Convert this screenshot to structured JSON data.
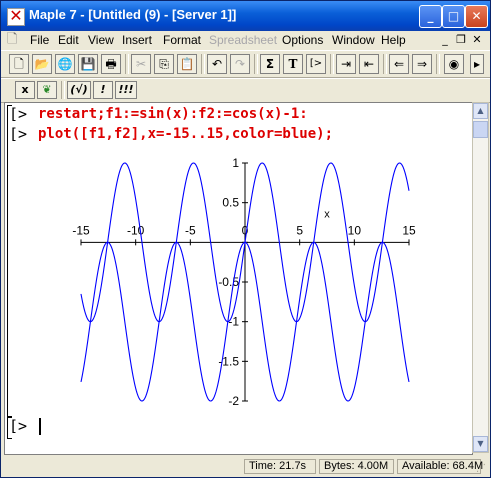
{
  "window": {
    "title": "Maple 7  - [Untitled (9) - [Server 1]]",
    "controls": {
      "minimize": "_",
      "maximize": "□",
      "close": "✕"
    }
  },
  "menubar": {
    "items": [
      {
        "label": "File",
        "enabled": true
      },
      {
        "label": "Edit",
        "enabled": true
      },
      {
        "label": "View",
        "enabled": true
      },
      {
        "label": "Insert",
        "enabled": true
      },
      {
        "label": "Format",
        "enabled": true
      },
      {
        "label": "Spreadsheet",
        "enabled": false
      },
      {
        "label": "Options",
        "enabled": true
      },
      {
        "label": "Window",
        "enabled": true
      },
      {
        "label": "Help",
        "enabled": true
      }
    ],
    "doc_controls": {
      "minimize": "_",
      "restore": "❐",
      "close": "✕"
    }
  },
  "toolbar1": {
    "buttons": [
      {
        "icon": "new-document-icon",
        "glyph": "🗋"
      },
      {
        "icon": "open-folder-icon",
        "glyph": "📂"
      },
      {
        "icon": "open-url-icon",
        "glyph": "🌐"
      },
      {
        "icon": "save-icon",
        "glyph": "💾"
      },
      {
        "icon": "print-icon",
        "glyph": "🖶"
      },
      {
        "icon": "cut-icon",
        "glyph": "✂"
      },
      {
        "icon": "copy-icon",
        "glyph": "⎘"
      },
      {
        "icon": "paste-icon",
        "glyph": "📋"
      },
      {
        "icon": "undo-icon",
        "glyph": "↶"
      },
      {
        "icon": "redo-icon",
        "glyph": "↷"
      },
      {
        "icon": "sigma-icon",
        "glyph": "Σ"
      },
      {
        "icon": "text-icon",
        "glyph": "T"
      },
      {
        "icon": "insert-prompt-icon",
        "glyph": "[>"
      },
      {
        "icon": "indent-icon",
        "glyph": "⇥"
      },
      {
        "icon": "outdent-icon",
        "glyph": "⇤"
      },
      {
        "icon": "back-arrow-icon",
        "glyph": "⇐"
      },
      {
        "icon": "forward-arrow-icon",
        "glyph": "⇒"
      },
      {
        "icon": "stop-icon",
        "glyph": "◉"
      }
    ]
  },
  "toolbar2": {
    "buttons": [
      {
        "icon": "clear-icon",
        "glyph": "x"
      },
      {
        "icon": "maple-leaf-icon",
        "glyph": "❦"
      },
      {
        "icon": "execute-selection-icon",
        "glyph": "(√)"
      },
      {
        "icon": "execute-icon",
        "glyph": "!"
      },
      {
        "icon": "execute-all-icon",
        "glyph": "!!!"
      }
    ]
  },
  "worksheet": {
    "prompt": "[>",
    "lines": [
      "restart;f1:=sin(x):f2:=cos(x)-1:",
      "plot([f1,f2],x=-15..15,color=blue);"
    ]
  },
  "statusbar": {
    "time": "Time:  21.7s",
    "bytes": "Bytes: 4.00M",
    "available": "Available: 68.4M"
  },
  "chart_data": {
    "type": "line",
    "functions": [
      "sin(x)",
      "cos(x)-1"
    ],
    "xlim": [
      -15,
      15
    ],
    "ylim": [
      -2,
      1
    ],
    "color": "#0000ff",
    "xlabel": "x",
    "ylabel": "",
    "x_ticks": [
      "-15",
      "-10",
      "-5",
      "0",
      "5",
      "10",
      "15"
    ],
    "y_ticks": [
      "1",
      "0.5",
      "0",
      "-0.5",
      "-1",
      "-1.5",
      "-2"
    ],
    "series": [
      {
        "name": "f1",
        "x": [
          -15,
          -14,
          -13,
          -12,
          -11,
          -10,
          -9,
          -8,
          -7,
          -6,
          -5,
          -4,
          -3,
          -2,
          -1,
          0,
          1,
          2,
          3,
          4,
          5,
          6,
          7,
          8,
          9,
          10,
          11,
          12,
          13,
          14,
          15
        ],
        "y": [
          -0.65,
          -0.99,
          -0.42,
          0.54,
          1.0,
          0.54,
          -0.41,
          -0.99,
          -0.66,
          0.28,
          0.96,
          0.76,
          -0.14,
          -0.91,
          -0.84,
          0,
          0.84,
          0.91,
          0.14,
          -0.76,
          -0.96,
          -0.28,
          0.66,
          0.99,
          0.41,
          -0.54,
          -1.0,
          -0.54,
          0.42,
          0.99,
          0.65
        ]
      },
      {
        "name": "f2",
        "x": [
          -15,
          -14,
          -13,
          -12,
          -11,
          -10,
          -9,
          -8,
          -7,
          -6,
          -5,
          -4,
          -3,
          -2,
          -1,
          0,
          1,
          2,
          3,
          4,
          5,
          6,
          7,
          8,
          9,
          10,
          11,
          12,
          13,
          14,
          15
        ],
        "y": [
          -1.76,
          -0.86,
          -0.09,
          -0.16,
          -0.99,
          -1.84,
          -1.91,
          -1.15,
          -0.25,
          -0.04,
          -0.72,
          -1.65,
          -1.99,
          -1.42,
          -0.46,
          0,
          -0.46,
          -1.42,
          -1.99,
          -1.65,
          -0.72,
          -0.04,
          -0.25,
          -1.15,
          -1.91,
          -1.84,
          -0.99,
          -0.16,
          -0.09,
          -0.86,
          -1.76
        ]
      }
    ]
  }
}
